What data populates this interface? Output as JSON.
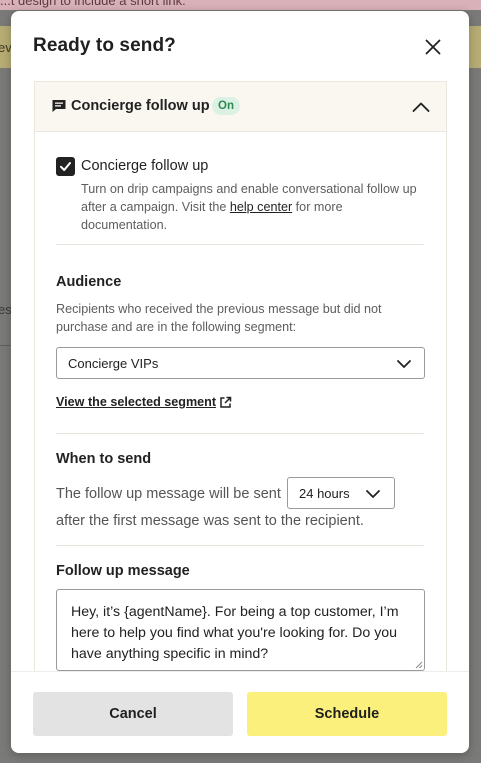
{
  "background": {
    "top_text": "...t design to include a short link.",
    "banner_text": "ev",
    "side_text": "es"
  },
  "modal": {
    "title": "Ready to send?",
    "close_icon": "close-icon"
  },
  "accordion": {
    "title": "Concierge follow up",
    "badge": "On",
    "icon": "chat-bubble-icon",
    "chevron": "chevron-up-icon"
  },
  "concierge": {
    "checked": true,
    "label": "Concierge follow up",
    "desc_before": "Turn on drip campaigns and enable conversational follow up after a campaign. Visit the ",
    "link": "help center",
    "desc_after": " for more documentation."
  },
  "audience": {
    "title": "Audience",
    "desc": "Recipients who received the previous message but did not purchase and are in the following segment:",
    "segment_value": "Concierge VIPs",
    "segment_link": "View the selected segment"
  },
  "when": {
    "title": "When to send",
    "text_before": "The follow up message will be sent",
    "hours_value": "24 hours",
    "text_after": "after the first message was sent to the recipient."
  },
  "message": {
    "title": "Follow up message",
    "value": "Hey, it’s {agentName}. For being a top customer, I’m here to help you find what you're looking for. Do you have anything specific in mind?"
  },
  "footer": {
    "cancel_label": "Cancel",
    "schedule_label": "Schedule"
  },
  "colors": {
    "schedule_button": "#fbf07c",
    "cancel_button": "#e3e3e3",
    "badge_bg": "#dcf1e4",
    "badge_text": "#2f8a52",
    "accordion_header": "#faf7f0"
  }
}
